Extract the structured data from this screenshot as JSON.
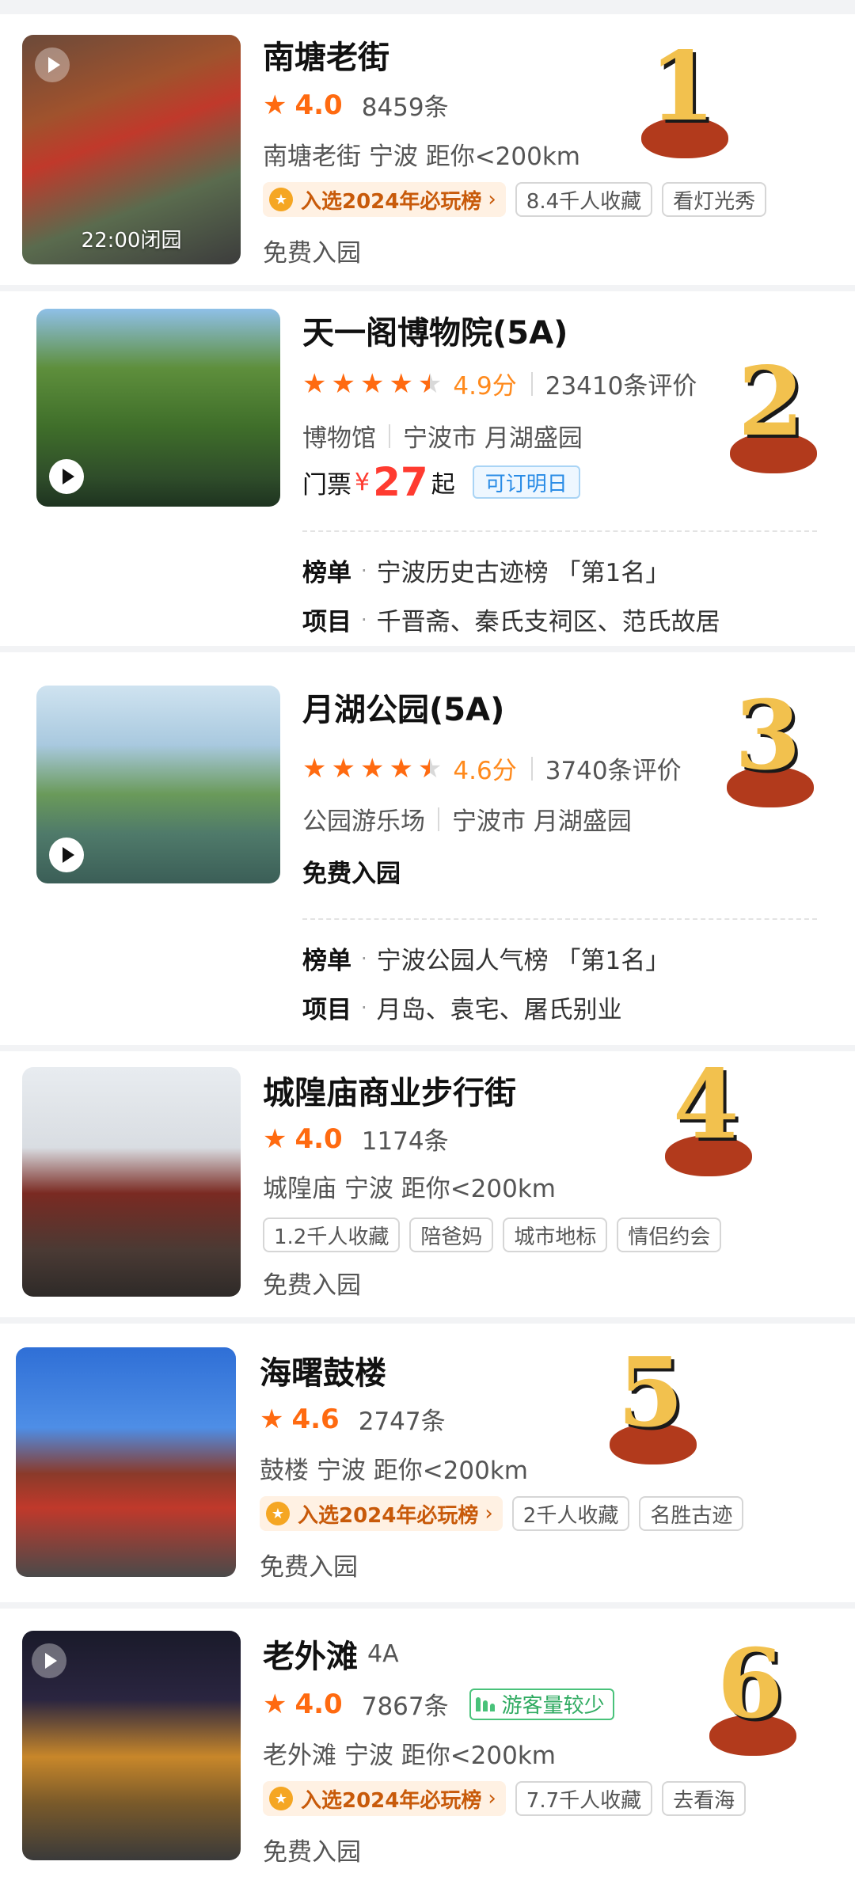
{
  "colors": {
    "accent_orange": "#ff6a10",
    "price_red": "#ff3b30",
    "badge_bg": "#fff1e3",
    "badge_text": "#c85a0a",
    "crowd_green": "#2eaa60",
    "book_blue": "#2a8ce6",
    "number_blob": "#b23a1c",
    "number_digit": "#f2c14e"
  },
  "items": [
    {
      "rank_mark": "1",
      "title": "南塘老街",
      "rating": "4.0",
      "review_count": "8459条",
      "location": "南塘老街  宁波 距你<200km",
      "thumb_overlay": "22:00闭园",
      "badge": "入选2024年必玩榜",
      "tags": [
        "8.4千人收藏",
        "看灯光秀"
      ],
      "entry": "免费入园"
    },
    {
      "rank_mark": "2",
      "title": "天一阁博物院(5A)",
      "rating_score": "4.9分",
      "rating_stars": 4.5,
      "review_count": "23410条评价",
      "category": "博物馆",
      "location": "宁波市 月湖盛园",
      "ticket_label": "门票",
      "price_symbol": "¥",
      "price": "27",
      "price_suffix": "起",
      "booking_tag": "可订明日",
      "ranking_label": "榜单",
      "ranking_value": "宁波历史古迹榜 「第1名」",
      "project_label": "项目",
      "project_value": "千晋斋、秦氏支祠区、范氏故居"
    },
    {
      "rank_mark": "3",
      "title": "月湖公园(5A)",
      "rating_score": "4.6分",
      "rating_stars": 4.5,
      "review_count": "3740条评价",
      "category": "公园游乐场",
      "location": "宁波市 月湖盛园",
      "entry": "免费入园",
      "ranking_label": "榜单",
      "ranking_value": "宁波公园人气榜 「第1名」",
      "project_label": "项目",
      "project_value": "月岛、袁宅、屠氏别业"
    },
    {
      "rank_mark": "4",
      "title": "城隍庙商业步行街",
      "rating": "4.0",
      "review_count": "1174条",
      "location": "城隍庙  宁波 距你<200km",
      "tags": [
        "1.2千人收藏",
        "陪爸妈",
        "城市地标",
        "情侣约会"
      ],
      "entry": "免费入园"
    },
    {
      "rank_mark": "5",
      "title": "海曙鼓楼",
      "rating": "4.6",
      "review_count": "2747条",
      "location": "鼓楼  宁波 距你<200km",
      "badge": "入选2024年必玩榜",
      "tags": [
        "2千人收藏",
        "名胜古迹"
      ],
      "entry": "免费入园"
    },
    {
      "rank_mark": "6",
      "title": "老外滩",
      "grade": "4A",
      "rating": "4.0",
      "review_count": "7867条",
      "crowd_tag": "游客量较少",
      "location": "老外滩  宁波 距你<200km",
      "badge": "入选2024年必玩榜",
      "tags": [
        "7.7千人收藏",
        "去看海"
      ],
      "entry": "免费入园"
    }
  ]
}
